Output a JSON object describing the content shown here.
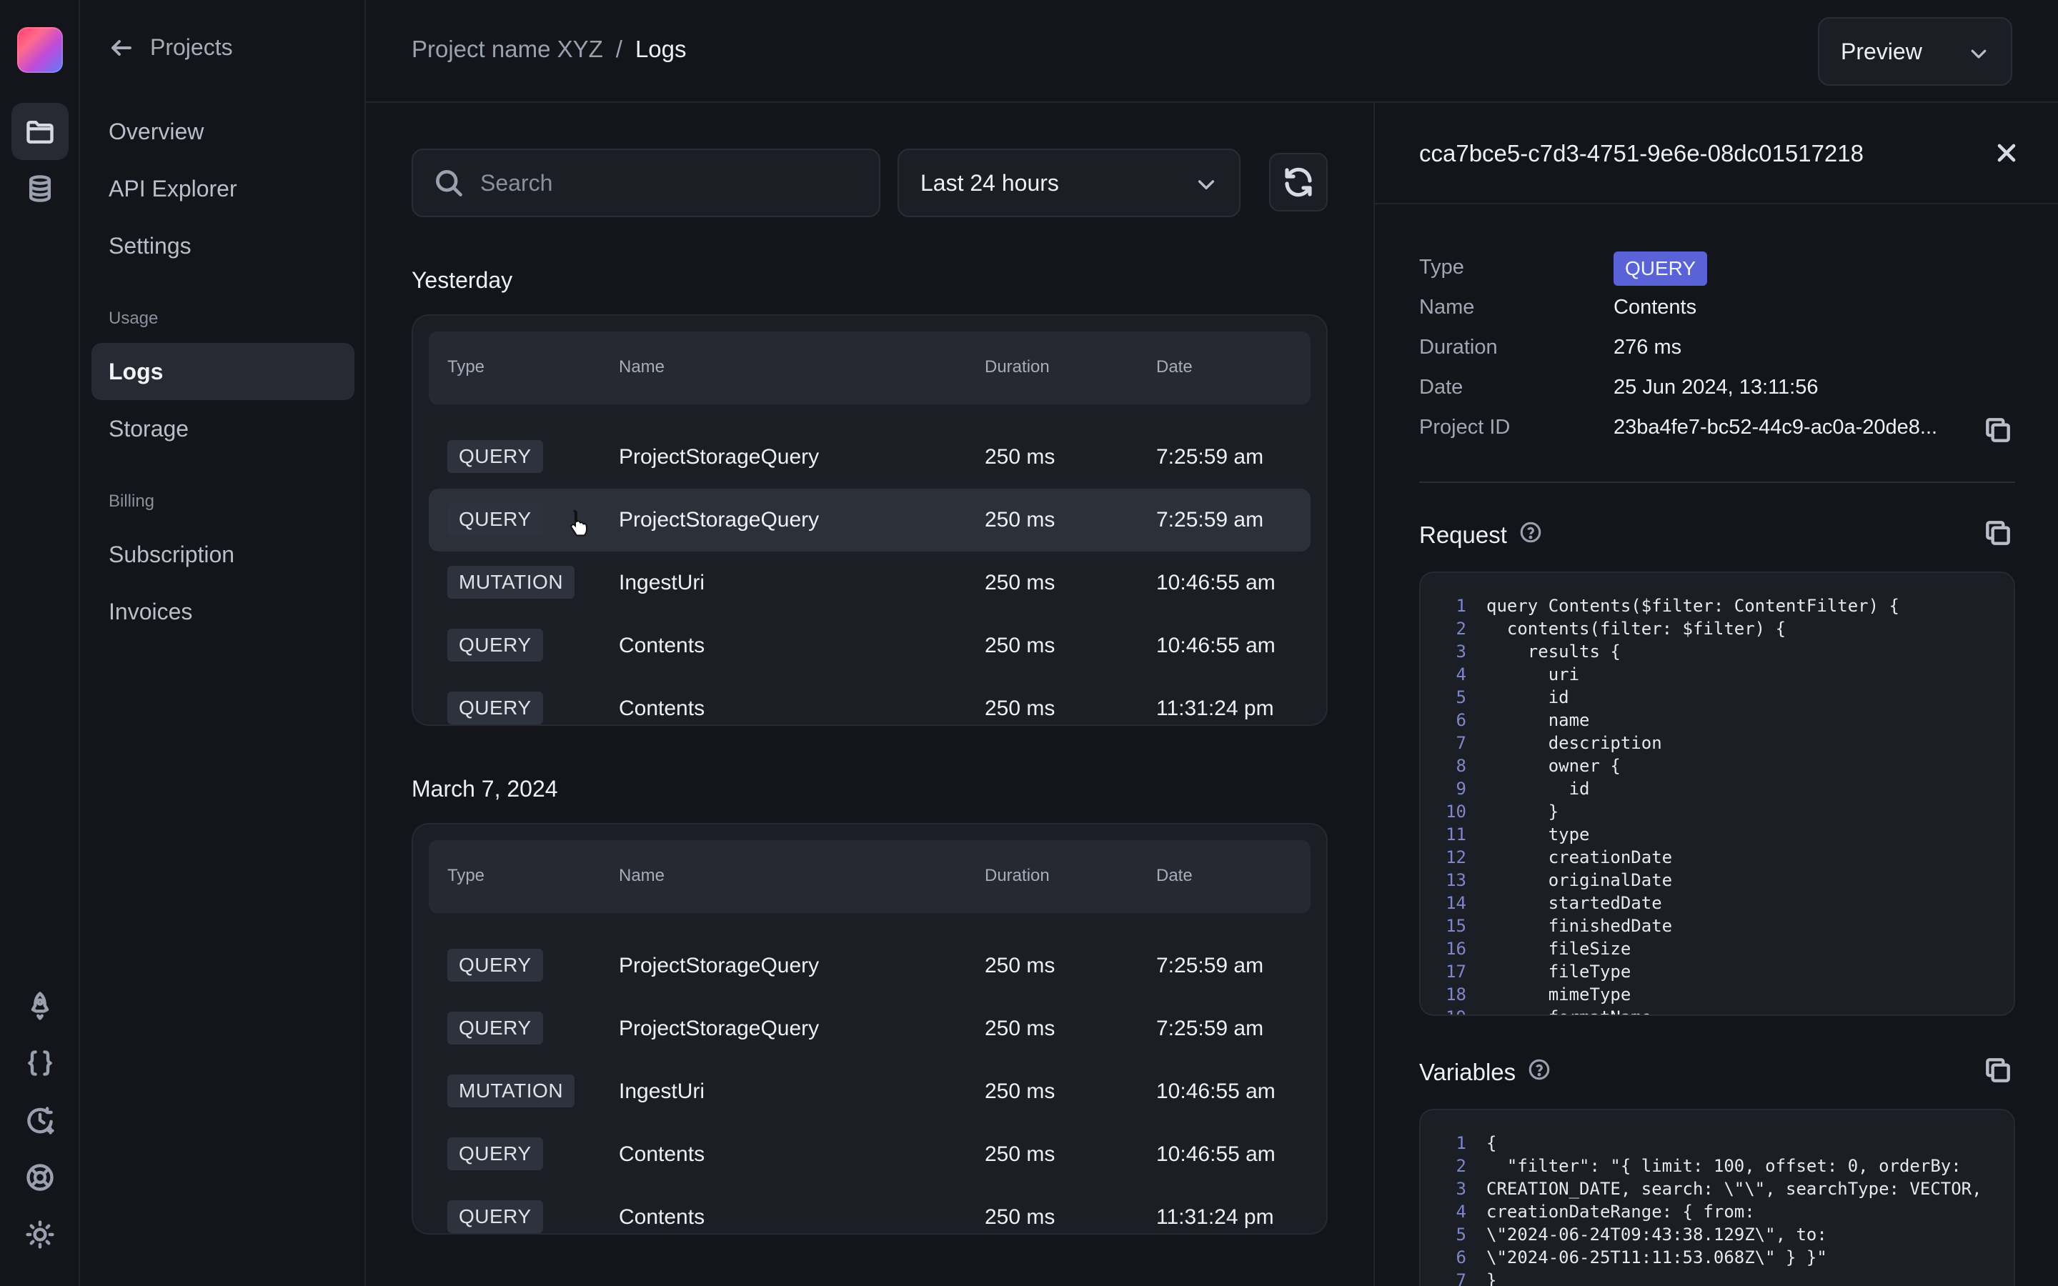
{
  "sidebar": {
    "back_label": "Projects",
    "items": [
      {
        "label": "Overview"
      },
      {
        "label": "API Explorer"
      },
      {
        "label": "Settings"
      }
    ],
    "usage_heading": "Usage",
    "usage_items": [
      {
        "label": "Logs",
        "active": true
      },
      {
        "label": "Storage"
      }
    ],
    "billing_heading": "Billing",
    "billing_items": [
      {
        "label": "Subscription"
      },
      {
        "label": "Invoices"
      }
    ]
  },
  "rail": {
    "icons": [
      "folder-icon",
      "database-icon",
      "rocket-icon",
      "braces-icon",
      "history-icon",
      "lifebuoy-icon",
      "sun-icon"
    ]
  },
  "header": {
    "project": "Project name XYZ",
    "separator": "/",
    "page": "Logs",
    "preview_label": "Preview"
  },
  "filters": {
    "search_placeholder": "Search",
    "range_value": "Last 24 hours"
  },
  "columns": {
    "type": "Type",
    "name": "Name",
    "duration": "Duration",
    "date": "Date"
  },
  "groups": [
    {
      "title": "Yesterday",
      "rows": [
        {
          "type": "QUERY",
          "name": "ProjectStorageQuery",
          "duration": "250 ms",
          "date": "7:25:59 am"
        },
        {
          "type": "QUERY",
          "name": "ProjectStorageQuery",
          "duration": "250 ms",
          "date": "7:25:59 am"
        },
        {
          "type": "MUTATION",
          "name": "IngestUri",
          "duration": "250 ms",
          "date": "10:46:55 am"
        },
        {
          "type": "QUERY",
          "name": "Contents",
          "duration": "250 ms",
          "date": "10:46:55 am"
        },
        {
          "type": "QUERY",
          "name": "Contents",
          "duration": "250 ms",
          "date": "11:31:24 pm"
        }
      ]
    },
    {
      "title": "March 7, 2024",
      "rows": [
        {
          "type": "QUERY",
          "name": "ProjectStorageQuery",
          "duration": "250 ms",
          "date": "7:25:59 am"
        },
        {
          "type": "QUERY",
          "name": "ProjectStorageQuery",
          "duration": "250 ms",
          "date": "7:25:59 am"
        },
        {
          "type": "MUTATION",
          "name": "IngestUri",
          "duration": "250 ms",
          "date": "10:46:55 am"
        },
        {
          "type": "QUERY",
          "name": "Contents",
          "duration": "250 ms",
          "date": "10:46:55 am"
        },
        {
          "type": "QUERY",
          "name": "Contents",
          "duration": "250 ms",
          "date": "11:31:24 pm"
        }
      ]
    }
  ],
  "detail": {
    "id": "cca7bce5-c7d3-4751-9e6e-08dc01517218",
    "labels": {
      "type": "Type",
      "name": "Name",
      "duration": "Duration",
      "date": "Date",
      "project_id": "Project ID"
    },
    "type": "QUERY",
    "name": "Contents",
    "duration": "276 ms",
    "date": "25 Jun 2024, 13:11:56",
    "project_id": "23ba4fe7-bc52-44c9-ac0a-20de8...",
    "request_title": "Request",
    "variables_title": "Variables",
    "request_lines": [
      "query Contents($filter: ContentFilter) {",
      "  contents(filter: $filter) {",
      "    results {",
      "      uri",
      "      id",
      "      name",
      "      description",
      "      owner {",
      "        id",
      "      }",
      "      type",
      "      creationDate",
      "      originalDate",
      "      startedDate",
      "      finishedDate",
      "      fileSize",
      "      fileType",
      "      mimeType",
      "      formatName"
    ],
    "variables_lines": [
      "{",
      "  \"filter\": \"{ limit: 100, offset: 0, orderBy:",
      "CREATION_DATE, search: \\\"\\\", searchType: VECTOR,",
      "creationDateRange: { from:",
      "\\\"2024-06-24T09:43:38.129Z\\\", to:",
      "\\\"2024-06-25T11:11:53.068Z\\\" } }\"",
      "}"
    ]
  },
  "colors": {
    "background": "#13151b",
    "panel": "#1b1e25",
    "query_badge": "#5a62d8",
    "line_numbers": "#7f86cc"
  }
}
